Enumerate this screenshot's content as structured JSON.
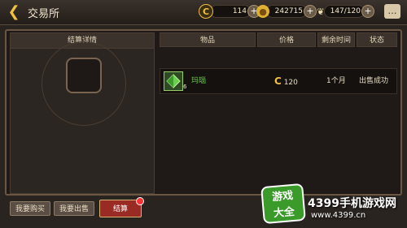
{
  "header": {
    "title": "交易所",
    "back_icon": "back-arrow-icon",
    "chat_icon": "chat-bubble-icon"
  },
  "resources": [
    {
      "icon": "c-coin-icon",
      "value": "114",
      "color": "#f0c040"
    },
    {
      "icon": "gold-coin-icon",
      "value": "242715",
      "color": "#e0b030"
    },
    {
      "icon": "wing-icon",
      "value": "147/120",
      "color": "#f0e0b0"
    }
  ],
  "settlement_panel": {
    "title": "结算详情"
  },
  "table": {
    "headers": [
      "物品",
      "价格",
      "剩余时间",
      "状态"
    ],
    "rows": [
      {
        "item": "玛瑙",
        "count": "6",
        "price": "120",
        "time": "1个月",
        "status": "出售成功"
      }
    ]
  },
  "tabs": [
    {
      "label": "我要购买",
      "active": false
    },
    {
      "label": "我要出售",
      "active": false
    },
    {
      "label": "结算",
      "active": true
    }
  ],
  "watermark": {
    "logo": "游戏大全",
    "title": "4399手机游戏网",
    "url": "www.4399.cn"
  }
}
